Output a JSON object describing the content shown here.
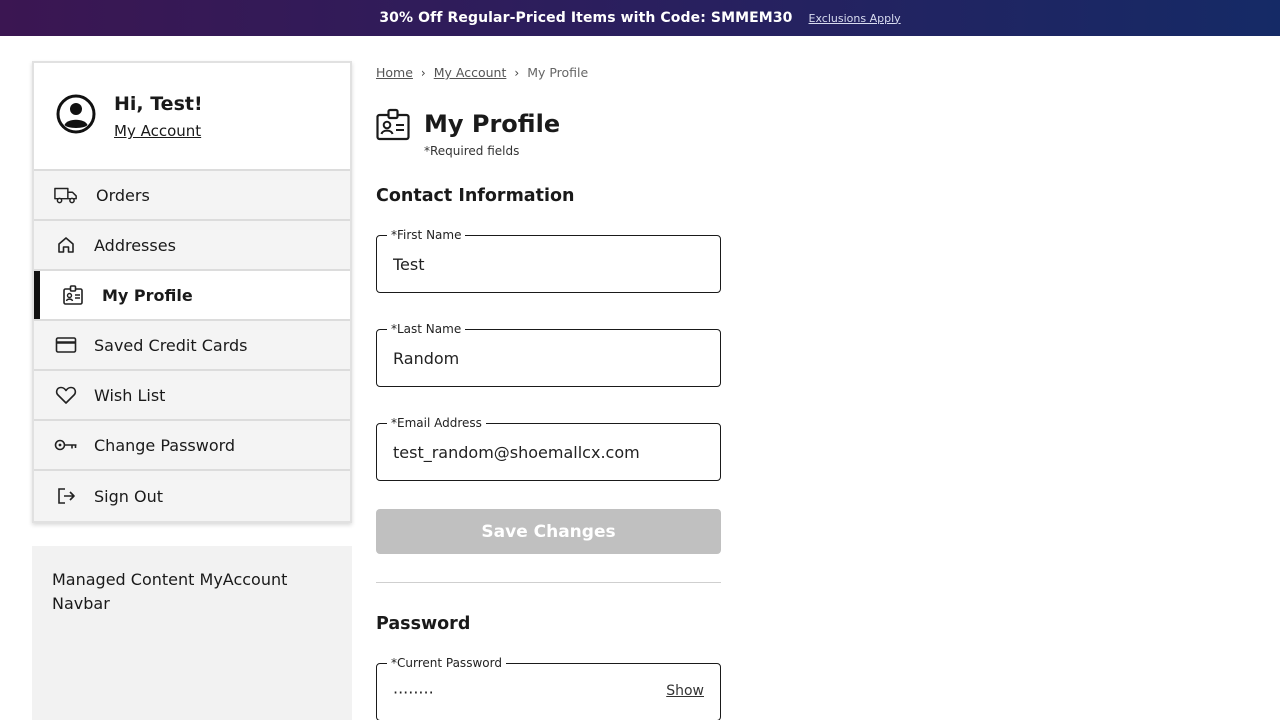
{
  "promo": {
    "text": "30% Off Regular-Priced Items with Code: SMMEM30",
    "link": "Exclusions Apply"
  },
  "sidebar": {
    "greeting": "Hi, Test!",
    "account_link": "My Account",
    "items": [
      {
        "label": "Orders",
        "icon": "truck-icon"
      },
      {
        "label": "Addresses",
        "icon": "home-icon"
      },
      {
        "label": "My Profile",
        "icon": "id-card-icon",
        "active": true
      },
      {
        "label": "Saved Credit Cards",
        "icon": "credit-card-icon"
      },
      {
        "label": "Wish List",
        "icon": "heart-icon"
      },
      {
        "label": "Change Password",
        "icon": "key-icon"
      },
      {
        "label": "Sign Out",
        "icon": "sign-out-icon"
      }
    ],
    "managed_content": "Managed Content MyAccount Navbar"
  },
  "breadcrumb": {
    "home": "Home",
    "my_account": "My Account",
    "current": "My Profile"
  },
  "page": {
    "title": "My Profile",
    "required_note": "*Required fields"
  },
  "contact": {
    "heading": "Contact Information",
    "first_name_label": "*First Name",
    "first_name_value": "Test",
    "last_name_label": "*Last Name",
    "last_name_value": "Random",
    "email_label": "*Email Address",
    "email_value": "test_random@shoemallcx.com",
    "save_label": "Save Changes"
  },
  "password": {
    "heading": "Password",
    "current_label": "*Current Password",
    "current_value": "········",
    "show_label": "Show"
  },
  "colors": {
    "promo_start": "#3b1652",
    "promo_end": "#152a66",
    "disabled_button": "#c0c0c0",
    "active_marker": "#111111"
  }
}
